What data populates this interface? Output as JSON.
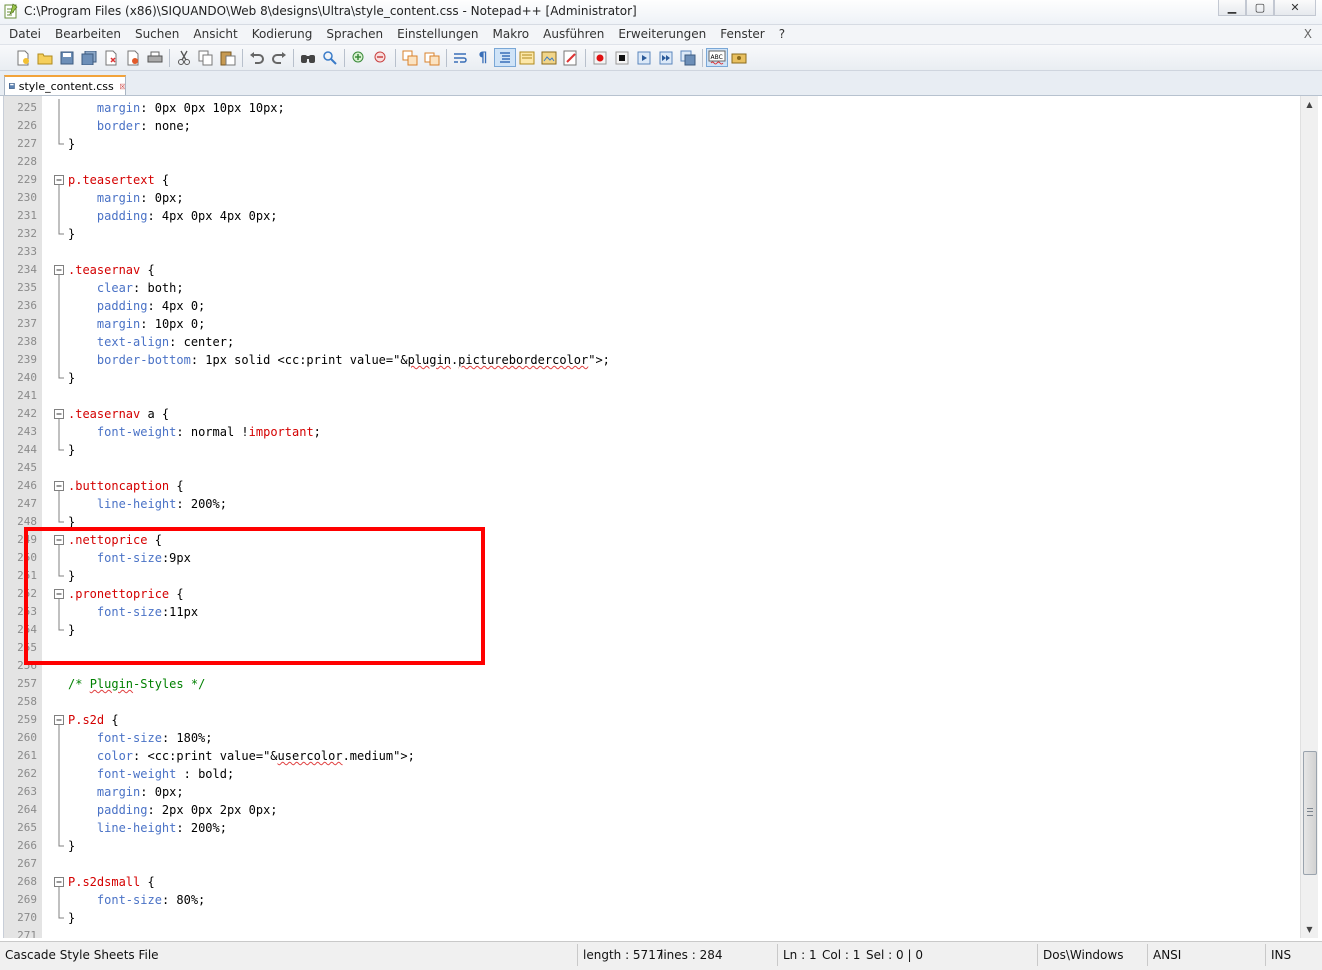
{
  "window": {
    "title": "C:\\Program Files (x86)\\SIQUANDO\\Web 8\\designs\\Ultra\\style_content.css - Notepad++ [Administrator]",
    "minimize": "▁",
    "maximize": "▢",
    "close": "✕"
  },
  "menu": {
    "items": [
      "Datei",
      "Bearbeiten",
      "Suchen",
      "Ansicht",
      "Kodierung",
      "Sprachen",
      "Einstellungen",
      "Makro",
      "Ausführen",
      "Erweiterungen",
      "Fenster",
      "?"
    ],
    "close_label": "X"
  },
  "tab": {
    "label": "style_content.css"
  },
  "editor": {
    "lines": [
      {
        "n": "225",
        "fold": "bar",
        "parts": [
          [
            "    ",
            ""
          ],
          [
            "margin",
            "prop"
          ],
          [
            ": 0px 0px 10px 10px;",
            "val"
          ]
        ]
      },
      {
        "n": "226",
        "fold": "bar",
        "parts": [
          [
            "    ",
            ""
          ],
          [
            "border",
            "prop"
          ],
          [
            ": none;",
            "val"
          ]
        ]
      },
      {
        "n": "227",
        "fold": "end",
        "parts": [
          [
            "}",
            "val"
          ]
        ]
      },
      {
        "n": "228",
        "fold": "",
        "parts": []
      },
      {
        "n": "229",
        "fold": "open",
        "parts": [
          [
            "p.teasertext",
            "sel"
          ],
          [
            " {",
            "val"
          ]
        ]
      },
      {
        "n": "230",
        "fold": "bar",
        "parts": [
          [
            "    ",
            ""
          ],
          [
            "margin",
            "prop"
          ],
          [
            ": 0px;",
            "val"
          ]
        ]
      },
      {
        "n": "231",
        "fold": "bar",
        "parts": [
          [
            "    ",
            ""
          ],
          [
            "padding",
            "prop"
          ],
          [
            ": 4px 0px 4px 0px;",
            "val"
          ]
        ]
      },
      {
        "n": "232",
        "fold": "end",
        "parts": [
          [
            "}",
            "val"
          ]
        ]
      },
      {
        "n": "233",
        "fold": "",
        "parts": []
      },
      {
        "n": "234",
        "fold": "open",
        "parts": [
          [
            ".teasernav",
            "sel"
          ],
          [
            " {",
            "val"
          ]
        ]
      },
      {
        "n": "235",
        "fold": "bar",
        "parts": [
          [
            "    ",
            ""
          ],
          [
            "clear",
            "prop"
          ],
          [
            ": both;",
            "val"
          ]
        ]
      },
      {
        "n": "236",
        "fold": "bar",
        "parts": [
          [
            "    ",
            ""
          ],
          [
            "padding",
            "prop"
          ],
          [
            ": 4px 0;",
            "val"
          ]
        ]
      },
      {
        "n": "237",
        "fold": "bar",
        "parts": [
          [
            "    ",
            ""
          ],
          [
            "margin",
            "prop"
          ],
          [
            ": 10px 0;",
            "val"
          ]
        ]
      },
      {
        "n": "238",
        "fold": "bar",
        "parts": [
          [
            "    ",
            ""
          ],
          [
            "text-align",
            "prop"
          ],
          [
            ": center;",
            "val"
          ]
        ]
      },
      {
        "n": "239",
        "fold": "bar",
        "parts": [
          [
            "    ",
            ""
          ],
          [
            "border-bottom",
            "prop"
          ],
          [
            ": 1px solid <cc:print value=\"&",
            "val"
          ],
          [
            "plugin",
            "val squig"
          ],
          [
            ".",
            "val"
          ],
          [
            "picturebordercolor",
            "val squig"
          ],
          [
            "\">;",
            "val"
          ]
        ]
      },
      {
        "n": "240",
        "fold": "end",
        "parts": [
          [
            "}",
            "val"
          ]
        ]
      },
      {
        "n": "241",
        "fold": "",
        "parts": []
      },
      {
        "n": "242",
        "fold": "open",
        "parts": [
          [
            ".teasernav",
            "sel"
          ],
          [
            " a {",
            "val"
          ]
        ]
      },
      {
        "n": "243",
        "fold": "bar",
        "parts": [
          [
            "    ",
            ""
          ],
          [
            "font-weight",
            "prop"
          ],
          [
            ": normal !",
            "val"
          ],
          [
            "important",
            "imp"
          ],
          [
            ";",
            "val"
          ]
        ]
      },
      {
        "n": "244",
        "fold": "end",
        "parts": [
          [
            "}",
            "val"
          ]
        ]
      },
      {
        "n": "245",
        "fold": "",
        "parts": []
      },
      {
        "n": "246",
        "fold": "open",
        "parts": [
          [
            ".buttoncaption",
            "sel"
          ],
          [
            " {",
            "val"
          ]
        ]
      },
      {
        "n": "247",
        "fold": "bar",
        "parts": [
          [
            "    ",
            ""
          ],
          [
            "line-height",
            "prop"
          ],
          [
            ": 200%;",
            "val"
          ]
        ]
      },
      {
        "n": "248",
        "fold": "end",
        "parts": [
          [
            "}",
            "val"
          ]
        ]
      },
      {
        "n": "249",
        "fold": "open",
        "parts": [
          [
            ".nettoprice",
            "sel"
          ],
          [
            " {",
            "val"
          ]
        ]
      },
      {
        "n": "250",
        "fold": "bar",
        "parts": [
          [
            "    ",
            ""
          ],
          [
            "font-size",
            "prop"
          ],
          [
            ":9px",
            "val"
          ]
        ]
      },
      {
        "n": "251",
        "fold": "end",
        "parts": [
          [
            "}",
            "val"
          ]
        ]
      },
      {
        "n": "252",
        "fold": "open",
        "parts": [
          [
            ".pronettoprice",
            "sel"
          ],
          [
            " {",
            "val"
          ]
        ]
      },
      {
        "n": "253",
        "fold": "bar",
        "parts": [
          [
            "    ",
            ""
          ],
          [
            "font-size",
            "prop"
          ],
          [
            ":11px",
            "val"
          ]
        ]
      },
      {
        "n": "254",
        "fold": "end",
        "parts": [
          [
            "}",
            "val"
          ]
        ]
      },
      {
        "n": "255",
        "fold": "",
        "parts": []
      },
      {
        "n": "256",
        "fold": "",
        "parts": []
      },
      {
        "n": "257",
        "fold": "",
        "parts": [
          [
            "/* ",
            "cm"
          ],
          [
            "Plugin",
            "cm squig"
          ],
          [
            "-Styles */",
            "cm"
          ]
        ]
      },
      {
        "n": "258",
        "fold": "",
        "parts": []
      },
      {
        "n": "259",
        "fold": "open",
        "parts": [
          [
            "P.s2d",
            "sel"
          ],
          [
            " {",
            "val"
          ]
        ]
      },
      {
        "n": "260",
        "fold": "bar",
        "parts": [
          [
            "    ",
            ""
          ],
          [
            "font-size",
            "prop"
          ],
          [
            ": 180%;",
            "val"
          ]
        ]
      },
      {
        "n": "261",
        "fold": "bar",
        "parts": [
          [
            "    ",
            ""
          ],
          [
            "color",
            "prop"
          ],
          [
            ": <cc:print value=\"&",
            "val"
          ],
          [
            "usercolor",
            "val squig"
          ],
          [
            ".medium\">;",
            "val"
          ]
        ]
      },
      {
        "n": "262",
        "fold": "bar",
        "parts": [
          [
            "    ",
            ""
          ],
          [
            "font-weight",
            "prop"
          ],
          [
            " : bold;",
            "val"
          ]
        ]
      },
      {
        "n": "263",
        "fold": "bar",
        "parts": [
          [
            "    ",
            ""
          ],
          [
            "margin",
            "prop"
          ],
          [
            ": 0px;",
            "val"
          ]
        ]
      },
      {
        "n": "264",
        "fold": "bar",
        "parts": [
          [
            "    ",
            ""
          ],
          [
            "padding",
            "prop"
          ],
          [
            ": 2px 0px 2px 0px;",
            "val"
          ]
        ]
      },
      {
        "n": "265",
        "fold": "bar",
        "parts": [
          [
            "    ",
            ""
          ],
          [
            "line-height",
            "prop"
          ],
          [
            ": 200%;",
            "val"
          ]
        ]
      },
      {
        "n": "266",
        "fold": "end",
        "parts": [
          [
            "}",
            "val"
          ]
        ]
      },
      {
        "n": "267",
        "fold": "",
        "parts": []
      },
      {
        "n": "268",
        "fold": "open",
        "parts": [
          [
            "P.s2dsmall",
            "sel"
          ],
          [
            " {",
            "val"
          ]
        ]
      },
      {
        "n": "269",
        "fold": "bar",
        "parts": [
          [
            "    ",
            ""
          ],
          [
            "font-size",
            "prop"
          ],
          [
            ": 80%;",
            "val"
          ]
        ]
      },
      {
        "n": "270",
        "fold": "end",
        "parts": [
          [
            "}",
            "val"
          ]
        ]
      },
      {
        "n": "271",
        "fold": "",
        "parts": []
      }
    ]
  },
  "status": {
    "file_type": "Cascade Style Sheets File",
    "length": "length : 5717",
    "lines": "lines : 284",
    "ln": "Ln : 1",
    "col": "Col : 1",
    "sel": "Sel : 0 | 0",
    "eol": "Dos\\Windows",
    "encoding": "ANSI",
    "mode": "INS"
  },
  "colors": {
    "selector": "#d40000",
    "property": "#4a72c6",
    "comment": "#008000",
    "highlight_box": "#ff0000"
  },
  "icons": [
    "new-file-icon",
    "open-file-icon",
    "save-icon",
    "save-all-icon",
    "close-icon",
    "close-all-icon",
    "print-icon",
    "cut-icon",
    "copy-icon",
    "paste-icon",
    "undo-icon",
    "redo-icon",
    "find-icon",
    "replace-icon",
    "zoom-in-icon",
    "zoom-out-icon",
    "sync-v-icon",
    "sync-h-icon",
    "wrap-icon",
    "all-chars-icon",
    "indent-guide-icon",
    "udl-icon",
    "doc-map-icon",
    "function-list-icon",
    "record-macro-icon",
    "stop-record-icon",
    "play-macro-icon",
    "run-macro-multi-icon",
    "save-macro-icon",
    "spellcheck-icon",
    "extra-icon"
  ]
}
